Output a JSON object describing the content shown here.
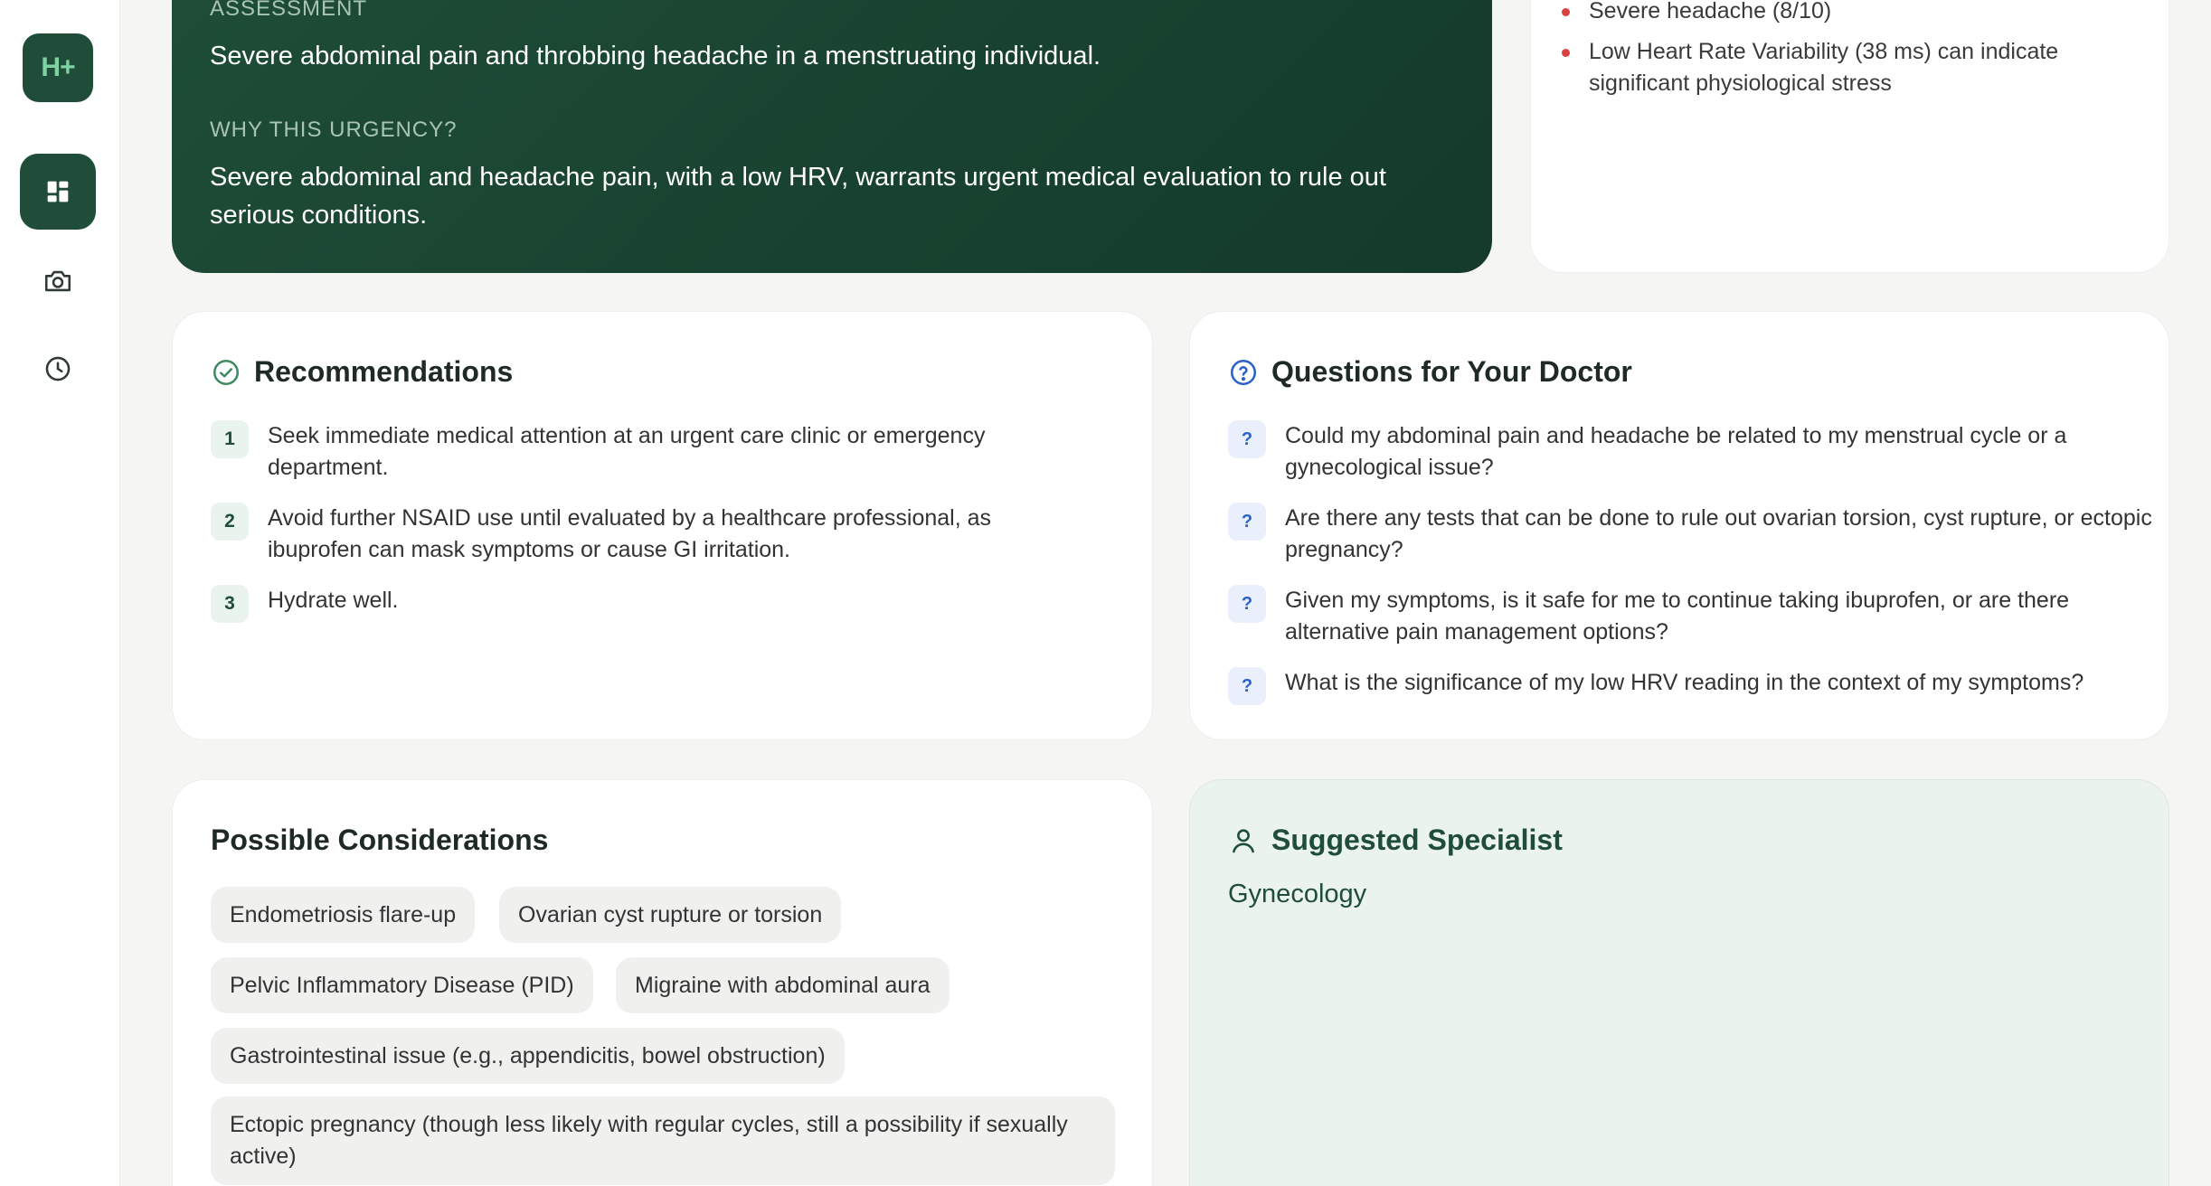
{
  "sidebar": {
    "logo_text": "H+",
    "items": [
      {
        "icon": "dashboard-icon",
        "active": true
      },
      {
        "icon": "camera-icon",
        "active": false
      },
      {
        "icon": "clock-icon",
        "active": false
      }
    ]
  },
  "assessment": {
    "label": "ASSESSMENT",
    "text": "Severe abdominal pain and throbbing headache in a menstruating individual.",
    "why_label": "WHY THIS URGENCY?",
    "why_text": "Severe abdominal and headache pain, with a low HRV, warrants urgent medical evaluation to rule out serious conditions."
  },
  "flags": {
    "items": [
      "Severe headache (8/10)",
      "Low Heart Rate Variability (38 ms) can indicate significant physiological stress"
    ],
    "dot_color": "#d94040"
  },
  "recommendations": {
    "title": "Recommendations",
    "items": [
      {
        "num": "1",
        "text": "Seek immediate medical attention at an urgent care clinic or emergency department."
      },
      {
        "num": "2",
        "text": "Avoid further NSAID use until evaluated by a healthcare professional, as ibuprofen can mask symptoms or cause GI irritation."
      },
      {
        "num": "3",
        "text": "Hydrate well."
      }
    ]
  },
  "questions": {
    "title": "Questions for Your Doctor",
    "badge": "?",
    "items": [
      "Could my abdominal pain and headache be related to my menstrual cycle or a gynecological issue?",
      "Are there any tests that can be done to rule out ovarian torsion, cyst rupture, or ectopic pregnancy?",
      "Given my symptoms, is it safe for me to continue taking ibuprofen, or are there alternative pain management options?",
      "What is the significance of my low HRV reading in the context of my symptoms?"
    ]
  },
  "considerations": {
    "title": "Possible Considerations",
    "chips": [
      "Endometriosis flare-up",
      "Ovarian cyst rupture or torsion",
      "Pelvic Inflammatory Disease (PID)",
      "Migraine with abdominal aura",
      "Gastrointestinal issue (e.g., appendicitis, bowel obstruction)",
      "Ectopic pregnancy (though less likely with regular cycles, still a possibility if sexually active)"
    ]
  },
  "specialist": {
    "title": "Suggested Specialist",
    "value": "Gynecology"
  },
  "colors": {
    "brand_dark": "#1f4d39",
    "accent_green": "#7fd3a3",
    "question_blue": "#2a62c9"
  }
}
